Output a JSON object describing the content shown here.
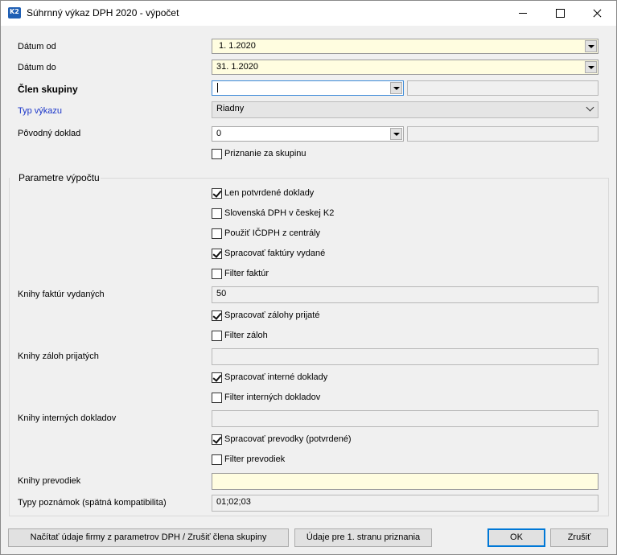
{
  "window": {
    "title": "Súhrnný výkaz DPH 2020 - výpočet"
  },
  "fields": {
    "datum_od": {
      "label": "Dátum od",
      "value": "1. 1.2020"
    },
    "datum_do": {
      "label": "Dátum do",
      "value": "31. 1.2020"
    },
    "clen_skupiny": {
      "label": "Člen skupiny",
      "value": "",
      "extra": ""
    },
    "typ_vykazu": {
      "label": "Typ výkazu",
      "value": "Riadny"
    },
    "povodny_doklad": {
      "label": "Pôvodný doklad",
      "value": "0",
      "extra": ""
    },
    "priznanie_za_skupinu": {
      "label": "Priznanie za skupinu",
      "checked": false
    }
  },
  "params": {
    "title": "Parametre výpočtu",
    "len_potvrdene": {
      "label": "Len potvrdené doklady",
      "checked": true
    },
    "slovenska_dph": {
      "label": "Slovenská DPH v českej K2",
      "checked": false
    },
    "pouzit_icdph": {
      "label": "Použiť IČDPH z centrály",
      "checked": false
    },
    "spracovat_faktury": {
      "label": "Spracovať faktúry vydané",
      "checked": true
    },
    "filter_faktur": {
      "label": "Filter faktúr",
      "checked": false
    },
    "knihy_faktur": {
      "label": "Knihy faktúr vydaných",
      "value": "50"
    },
    "spracovat_zalohy": {
      "label": "Spracovať zálohy prijaté",
      "checked": true
    },
    "filter_zaloh": {
      "label": "Filter záloh",
      "checked": false
    },
    "knihy_zaloh": {
      "label": "Knihy záloh prijatých",
      "value": ""
    },
    "spracovat_interne": {
      "label": "Spracovať interné doklady",
      "checked": true
    },
    "filter_internych": {
      "label": "Filter interných dokladov",
      "checked": false
    },
    "knihy_internych": {
      "label": "Knihy interných dokladov",
      "value": ""
    },
    "spracovat_prevodky": {
      "label": "Spracovať prevodky (potvrdené)",
      "checked": true
    },
    "filter_prevodiek": {
      "label": "Filter prevodiek",
      "checked": false
    },
    "knihy_prevodiek": {
      "label": "Knihy prevodiek",
      "value": ""
    },
    "typy_poznamok": {
      "label": "Typy poznámok (spätná kompatibilita)",
      "value": "01;02;03"
    }
  },
  "buttons": {
    "nacitat": "Načítať údaje firmy z parametrov DPH / Zrušiť člena skupiny",
    "udaje": "Údaje pre 1. stranu priznania",
    "ok": "OK",
    "zrusit": "Zrušiť"
  },
  "colors": {
    "required_field": "#fffde0",
    "link_label": "#1a35c9",
    "focus_border": "#3c8ad8"
  }
}
